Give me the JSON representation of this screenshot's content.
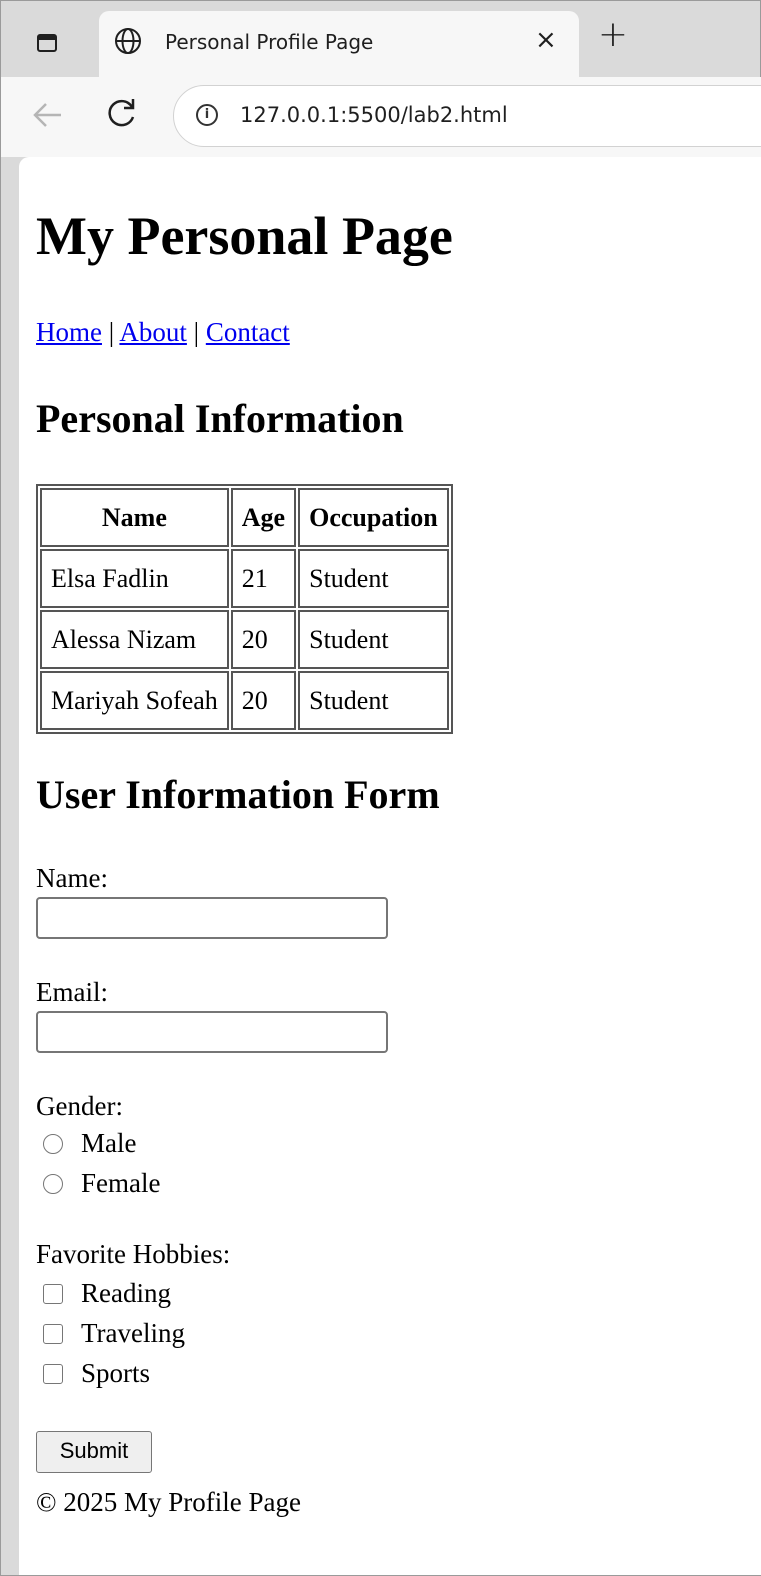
{
  "browser": {
    "tab_title": "Personal Profile Page",
    "tab_close": "×",
    "new_tab": "+",
    "url": "127.0.0.1:5500/lab2.html",
    "site_info_glyph": "i"
  },
  "page": {
    "heading": "My Personal Page",
    "nav_links": [
      {
        "label": "Home"
      },
      {
        "label": "About"
      },
      {
        "label": "Contact"
      }
    ],
    "nav_separator": "|",
    "info_heading": "Personal Information",
    "table": {
      "headers": [
        "Name",
        "Age",
        "Occupation"
      ],
      "rows": [
        [
          "Elsa Fadlin",
          "21",
          "Student"
        ],
        [
          "Alessa Nizam",
          "20",
          "Student"
        ],
        [
          "Mariyah Sofeah",
          "20",
          "Student"
        ]
      ]
    },
    "form_heading": "User Information Form",
    "form": {
      "name_label": "Name:",
      "name_value": "",
      "email_label": "Email:",
      "email_value": "",
      "gender_label": "Gender:",
      "gender_options": [
        "Male",
        "Female"
      ],
      "hobbies_label": "Favorite Hobbies:",
      "hobby_options": [
        "Reading",
        "Traveling",
        "Sports"
      ],
      "submit_label": "Submit"
    },
    "footer": "© 2025 My Profile Page"
  }
}
